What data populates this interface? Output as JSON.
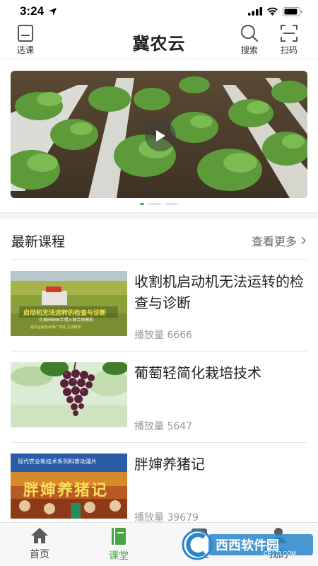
{
  "status": {
    "time": "3:24"
  },
  "header": {
    "title": "冀农云",
    "left_label": "选课",
    "search_label": "搜索",
    "scan_label": "扫码"
  },
  "section": {
    "title": "最新课程",
    "more_label": "查看更多"
  },
  "courses": [
    {
      "title": "收割机启动机无法运转的检查与诊断",
      "plays": "播放量 6666",
      "thumb_text_1": "启动机无法运转的检查与诊断",
      "thumb_text_2": "久保田888半喂入联合收割机",
      "thumb_text_3": "省农业新技术推广学校 主讲教师"
    },
    {
      "title": "葡萄轻简化栽培技术",
      "plays": "播放量 5647"
    },
    {
      "title": "胖婶养猪记",
      "plays": "播放量 39679",
      "thumb_text_1": "现代农业新技术系列科普动漫片",
      "thumb_text_2": "胖婶养猪记"
    }
  ],
  "tabs": [
    {
      "label": "首页",
      "active": false
    },
    {
      "label": "课堂",
      "active": true
    },
    {
      "label": "社区",
      "active": false
    },
    {
      "label": "我的",
      "active": false
    }
  ],
  "watermark": {
    "brand": "西西软件园",
    "domain": "CR173.COM"
  },
  "colors": {
    "accent": "#47a447",
    "text": "#222222",
    "muted": "#999999"
  }
}
